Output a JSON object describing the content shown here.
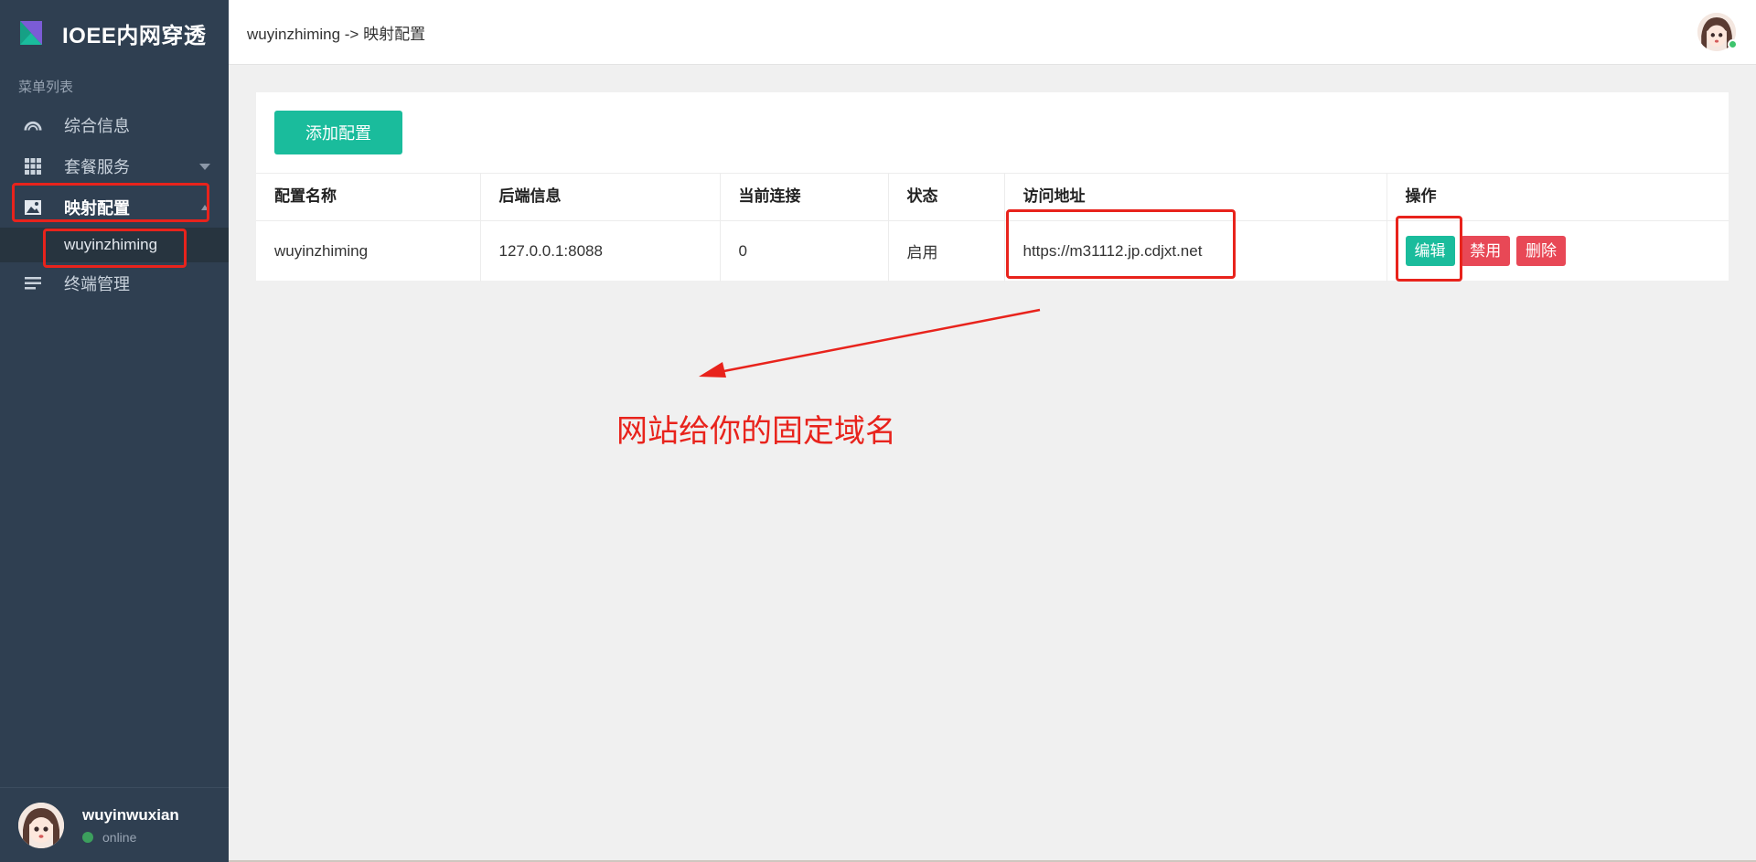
{
  "sidebar": {
    "brand_title": "IOEE内网穿透",
    "menu_caption": "菜单列表",
    "items": [
      {
        "label": "综合信息",
        "icon": "gauge-icon"
      },
      {
        "label": "套餐服务",
        "icon": "grid-icon"
      },
      {
        "label": "映射配置",
        "icon": "image-icon"
      },
      {
        "label": "终端管理",
        "icon": "list-icon"
      }
    ],
    "submenu": [
      "wuyinzhiming"
    ],
    "user": {
      "name": "wuyinwuxian",
      "status": "online"
    }
  },
  "header": {
    "breadcrumb": "wuyinzhiming -> 映射配置"
  },
  "main": {
    "add_button": "添加配置",
    "table": {
      "headers": [
        "配置名称",
        "后端信息",
        "当前连接",
        "状态",
        "访问地址",
        "操作"
      ],
      "rows": [
        {
          "name": "wuyinzhiming",
          "backend": "127.0.0.1:8088",
          "connections": "0",
          "status": "启用",
          "url": "https://m31112.jp.cdjxt.net",
          "actions": [
            "编辑",
            "禁用",
            "删除"
          ]
        }
      ]
    }
  },
  "annotation": {
    "text": "网站给你的固定域名"
  },
  "colors": {
    "sidebar": "#2f3f51",
    "accent": "#1abc9c",
    "danger": "#e84856",
    "annotation": "#e8231c"
  }
}
